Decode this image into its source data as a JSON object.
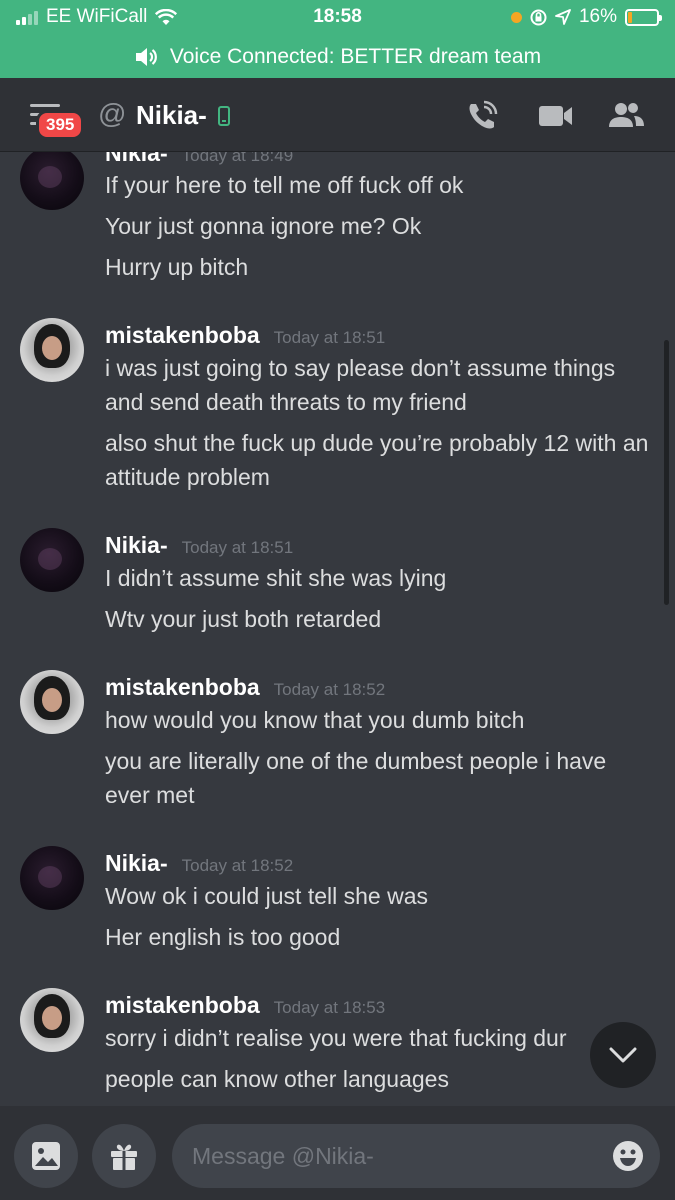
{
  "status_bar": {
    "carrier": "EE WiFiCall",
    "time": "18:58",
    "battery": "16%",
    "battery_level": 0.16,
    "icons": [
      "signal-icon",
      "wifi-icon",
      "orientation-lock-icon",
      "location-icon",
      "battery-icon"
    ]
  },
  "voice_bar": {
    "text": "Voice Connected: BETTER dream team",
    "icon": "speaker-icon"
  },
  "header": {
    "badge": "395",
    "title": "Nikia-",
    "icons": [
      "menu-icon",
      "at-icon",
      "mobile-icon",
      "call-icon",
      "video-icon",
      "members-icon"
    ]
  },
  "colors": {
    "status_green": "#43b581",
    "background": "#36393f",
    "header_bg": "#2f3136",
    "badge_red": "#f04747",
    "input_bg": "#40444b",
    "timestamp": "#72767d",
    "text": "#dcddde"
  },
  "messages": [
    {
      "author": "Nikia-",
      "time": "Today at 18:49",
      "lines": [
        "If your here to tell me off fuck off ok",
        "Your just gonna ignore me? Ok",
        "Hurry up bitch"
      ]
    },
    {
      "author": "mistakenboba",
      "time": "Today at 18:51",
      "lines": [
        "i was just going to say please don’t assume things and send death threats to my friend",
        "also shut the fuck up dude you’re probably 12 with an attitude problem"
      ]
    },
    {
      "author": "Nikia-",
      "time": "Today at 18:51",
      "lines": [
        "I didn’t assume shit she was lying",
        "Wtv your just both retarded"
      ]
    },
    {
      "author": "mistakenboba",
      "time": "Today at 18:52",
      "lines": [
        "how would you know that you dumb bitch",
        "you are literally one of the dumbest people i have ever met"
      ]
    },
    {
      "author": "Nikia-",
      "time": "Today at 18:52",
      "lines": [
        "Wow ok i could just tell she was",
        "Her english is too good"
      ]
    },
    {
      "author": "mistakenboba",
      "time": "Today at 18:53",
      "lines": [
        "sorry i didn’t realise you were that fucking dur",
        "people can know other languages"
      ]
    }
  ],
  "composer": {
    "placeholder": "Message @Nikia-",
    "icons": [
      "image-icon",
      "gift-icon",
      "emoji-icon",
      "chevron-down-icon"
    ]
  }
}
